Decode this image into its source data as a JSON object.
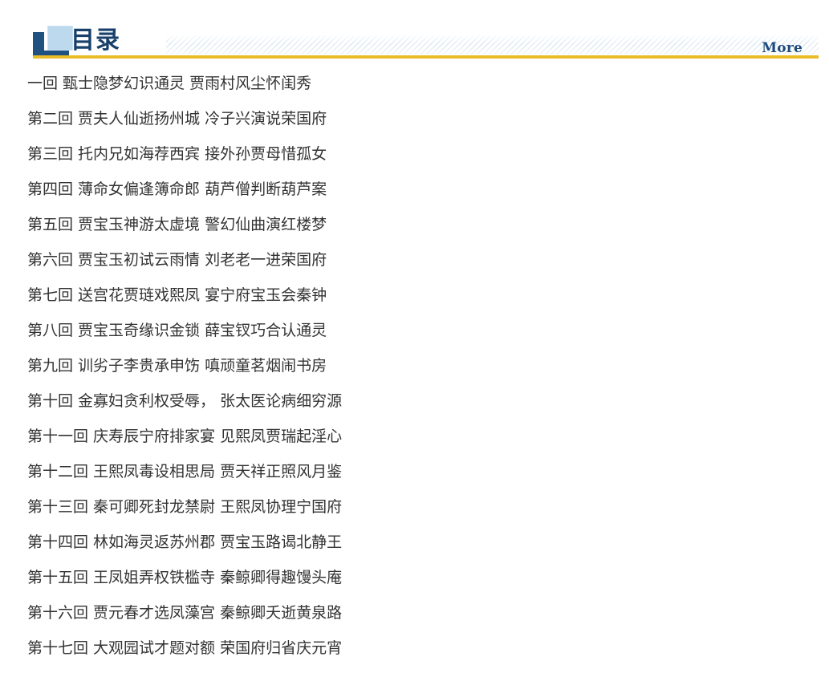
{
  "header": {
    "title": "目录",
    "more_label": "More",
    "logo_icon": "book-logo-icon",
    "accent_color": "#e8bc26",
    "brand_color": "#18406b",
    "square_color": "#bcd9ee",
    "hatch_color": "#dfeaf4"
  },
  "toc": {
    "items": [
      {
        "label": "一回 甄士隐梦幻识通灵 贾雨村风尘怀闺秀"
      },
      {
        "label": "第二回 贾夫人仙逝扬州城 冷子兴演说荣国府"
      },
      {
        "label": "第三回 托内兄如海荐西宾 接外孙贾母惜孤女"
      },
      {
        "label": "第四回 薄命女偏逢簿命郎 葫芦僧判断葫芦案"
      },
      {
        "label": "第五回 贾宝玉神游太虚境 警幻仙曲演红楼梦"
      },
      {
        "label": "第六回 贾宝玉初试云雨情 刘老老一进荣国府"
      },
      {
        "label": "第七回 送宫花贾琏戏熙凤 宴宁府宝玉会秦钟"
      },
      {
        "label": "第八回 贾宝玉奇缘识金锁 薛宝钗巧合认通灵"
      },
      {
        "label": "第九回 训劣子李贵承申饬 嗔顽童茗烟闹书房"
      },
      {
        "label": "第十回 金寡妇贪利权受辱， 张太医论病细穷源"
      },
      {
        "label": "第十一回 庆寿辰宁府排家宴 见熙凤贾瑞起淫心"
      },
      {
        "label": "第十二回 王熙凤毒设相思局 贾天祥正照风月鉴"
      },
      {
        "label": "第十三回 秦可卿死封龙禁尉 王熙凤协理宁国府"
      },
      {
        "label": "第十四回 林如海灵返苏州郡 贾宝玉路谒北静王"
      },
      {
        "label": "第十五回 王凤姐弄权铁槛寺 秦鲸卿得趣馒头庵"
      },
      {
        "label": "第十六回 贾元春才选凤藻宫 秦鲸卿夭逝黄泉路"
      },
      {
        "label": "第十七回 大观园试才题对额 荣国府归省庆元宵"
      }
    ]
  }
}
